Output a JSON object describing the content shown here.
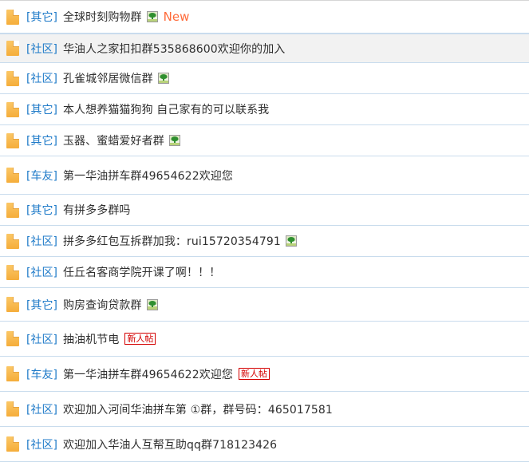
{
  "list": {
    "name": "forum-thread-list",
    "colors": {
      "link": "#1e7ac8",
      "title": "#2f2f2f",
      "new": "#ff6a39",
      "badge": "#d40000",
      "divider": "#c9dced",
      "highlight_bg": "#f2f2f2",
      "folder_icon": "#f8b84e"
    },
    "rows": [
      {
        "icon": "document-icon",
        "category": "[其它]",
        "title": "全球时刻购物群",
        "attachment": "image-attachment-icon",
        "new_label": "New",
        "badge": "",
        "highlight": false,
        "height": "h-40"
      },
      {
        "icon": "document-icon",
        "category": "[社区]",
        "title": "华油人之家扣扣群535868600欢迎你的加入",
        "attachment": "",
        "new_label": "",
        "badge": "",
        "highlight": true,
        "height": "h-37"
      },
      {
        "icon": "document-icon",
        "category": "[社区]",
        "title": "孔雀城邻居微信群",
        "attachment": "image-attachment-icon",
        "new_label": "",
        "badge": "",
        "highlight": false,
        "height": "h-39"
      },
      {
        "icon": "document-icon",
        "category": "[其它]",
        "title": "本人想养猫猫狗狗 自己家有的可以联系我",
        "attachment": "",
        "new_label": "",
        "badge": "",
        "highlight": false,
        "height": "h-39"
      },
      {
        "icon": "document-icon",
        "category": "[其它]",
        "title": "玉器、蜜蜡爱好者群",
        "attachment": "image-attachment-icon",
        "new_label": "",
        "badge": "",
        "highlight": false,
        "height": "h-39"
      },
      {
        "icon": "document-icon",
        "category": "[车友]",
        "title": "第一华油拼车群49654622欢迎您",
        "attachment": "",
        "new_label": "",
        "badge": "",
        "highlight": false,
        "height": "h-48"
      },
      {
        "icon": "document-icon",
        "category": "[其它]",
        "title": "有拼多多群吗",
        "attachment": "",
        "new_label": "",
        "badge": "",
        "highlight": false,
        "height": "h-39"
      },
      {
        "icon": "document-icon",
        "category": "[社区]",
        "title": "拼多多红包互拆群加我：rui15720354791",
        "attachment": "image-attachment-icon",
        "new_label": "",
        "badge": "",
        "highlight": false,
        "height": "h-39"
      },
      {
        "icon": "document-icon",
        "category": "[社区]",
        "title": "任丘名客商学院开课了啊！！！",
        "attachment": "",
        "new_label": "",
        "badge": "",
        "highlight": false,
        "height": "h-39"
      },
      {
        "icon": "document-icon",
        "category": "[其它]",
        "title": "购房查询贷款群",
        "attachment": "image-attachment-icon",
        "new_label": "",
        "badge": "",
        "highlight": false,
        "height": "h-42"
      },
      {
        "icon": "document-icon",
        "category": "[社区]",
        "title": "抽油机节电",
        "attachment": "",
        "new_label": "",
        "badge": "新人帖",
        "highlight": false,
        "height": "h-44"
      },
      {
        "icon": "document-icon",
        "category": "[车友]",
        "title": "第一华油拼车群49654622欢迎您",
        "attachment": "",
        "new_label": "",
        "badge": "新人帖",
        "highlight": false,
        "height": "h-44"
      },
      {
        "icon": "document-icon",
        "category": "[社区]",
        "title": "欢迎加入河间华油拼车第 ①群，群号码：465017581",
        "attachment": "",
        "new_label": "",
        "badge": "",
        "highlight": false,
        "height": "h-44"
      },
      {
        "icon": "document-icon",
        "category": "[社区]",
        "title": "欢迎加入华油人互帮互助qq群718123426",
        "attachment": "",
        "new_label": "",
        "badge": "",
        "highlight": false,
        "height": "h-44"
      }
    ]
  }
}
